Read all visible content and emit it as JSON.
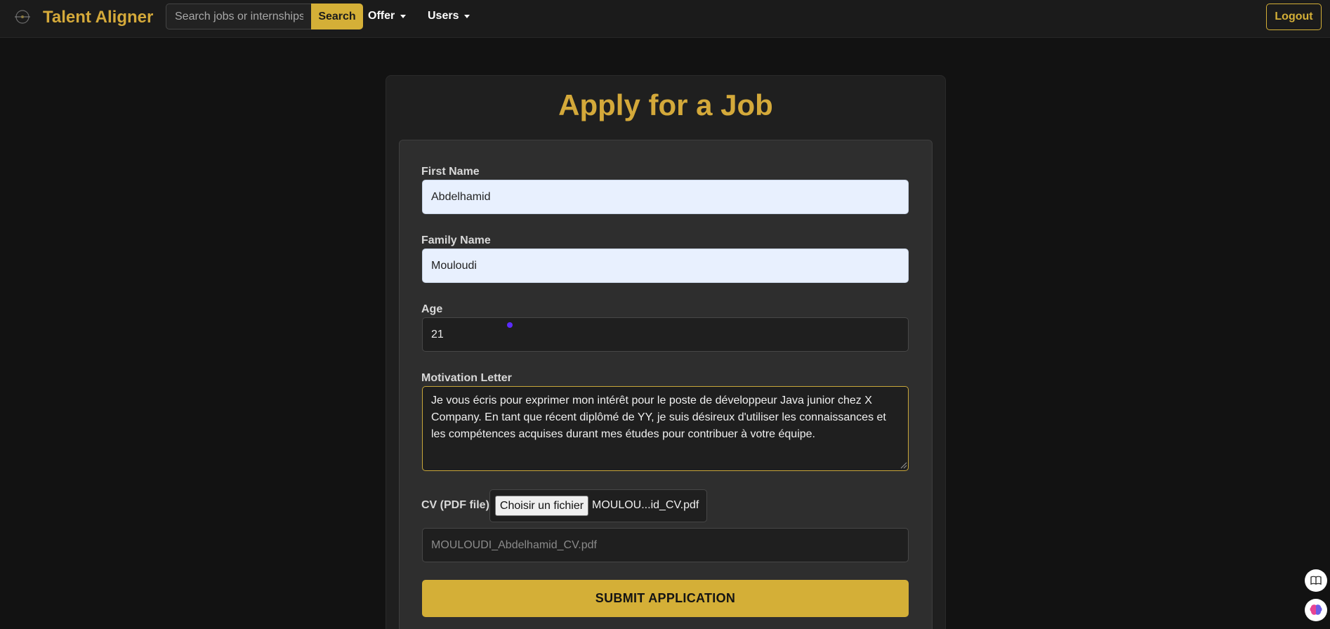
{
  "navbar": {
    "brand": "Talent Aligner",
    "logo_icon": "compass-logo-icon",
    "search_placeholder": "Search jobs or internships",
    "search_label": "Search",
    "menu_offer": "Offer",
    "menu_users": "Users",
    "logout_label": "Logout"
  },
  "page": {
    "title": "Apply for a Job"
  },
  "form": {
    "first_name_label": "First Name",
    "first_name_value": "Abdelhamid",
    "family_name_label": "Family Name",
    "family_name_value": "Mouloudi",
    "age_label": "Age",
    "age_value": "21",
    "letter_label": "Motivation Letter",
    "letter_value": "Je vous écris pour exprimer mon intérêt pour le poste de développeur Java junior chez X Company. En tant que récent diplômé de YY, je suis désireux d'utiliser les connaissances et les compétences acquises durant mes études pour contribuer à votre équipe.",
    "cv_label": "CV (PDF file)",
    "file_button_label": "Choisir un fichier",
    "file_chosen": "MOULOU...id_CV.pdf",
    "cv_filename_value": "MOULOUDI_Abdelhamid_CV.pdf",
    "submit_label": "SUBMIT APPLICATION"
  },
  "colors": {
    "accent": "#d4af37",
    "background": "#121212",
    "panel": "#2e2e2e"
  },
  "side_buttons": [
    "book-icon",
    "brain-icon"
  ]
}
